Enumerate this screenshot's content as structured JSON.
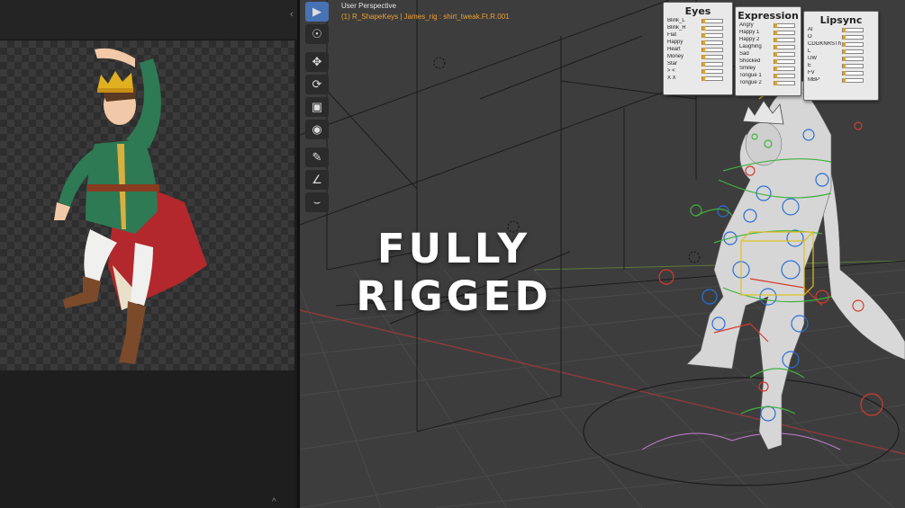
{
  "viewport": {
    "perspective_label": "User Perspective",
    "object_info": "(1) R_ShapeKeys | James_rig : shirt_tweak.Ft.R.001",
    "overlay_title": "FULLY RIGGED"
  },
  "toolbar": {
    "tools": [
      "select-box",
      "cursor",
      "move",
      "rotate",
      "scale",
      "transform",
      "annotate",
      "measure",
      "curve-edit"
    ]
  },
  "left_panel": {
    "collapse_glyph": "‹",
    "scroll_glyph": "^"
  },
  "shape_key_panels": [
    {
      "title": "Eyes",
      "rows": [
        "Blink_L",
        "Blink_R",
        "Flat",
        "Happy",
        "Heart",
        "Money",
        "Star",
        "> <",
        "X X"
      ]
    },
    {
      "title": "Expression",
      "rows": [
        "Angry",
        "Happy 1",
        "Happy 2",
        "Laughing",
        "Sad",
        "Shocked",
        "Smiley",
        "Tongue 1",
        "Tongue 2"
      ]
    },
    {
      "title": "Lipsync",
      "rows": [
        "AI",
        "O",
        "CDGKNRSTh",
        "L",
        "UW",
        "E",
        "FV",
        "MBP"
      ]
    }
  ],
  "colors": {
    "active_tool": "#4772b3",
    "object_info": "#f0a030",
    "rig_blue": "#2b6fd6",
    "rig_red": "#d63a2b",
    "rig_green": "#3fb03f",
    "rig_yellow": "#e0c020"
  }
}
